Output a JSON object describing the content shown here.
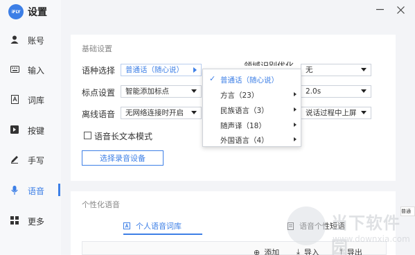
{
  "app": {
    "logo_text": "iFLY",
    "title": "设置"
  },
  "sidebar": {
    "items": [
      {
        "label": "账号",
        "icon": "user-icon"
      },
      {
        "label": "输入",
        "icon": "keyboard-icon"
      },
      {
        "label": "词库",
        "icon": "dictionary-icon"
      },
      {
        "label": "按键",
        "icon": "key-icon"
      },
      {
        "label": "手写",
        "icon": "pen-icon"
      },
      {
        "label": "语音",
        "icon": "microphone-icon",
        "active": true
      },
      {
        "label": "更多",
        "icon": "grid-icon"
      }
    ]
  },
  "window": {
    "minimize_glyph": "—",
    "close_glyph": "✕"
  },
  "basic": {
    "section_title": "基础设置",
    "language_label": "语种选择",
    "language_value": "普通话（随心说）",
    "punct_label": "标点设置",
    "punct_value": "智能添加标点",
    "offline_label": "离线语音",
    "offline_value": "无网络连接时开启",
    "domain_label_partial": "领域识别优化",
    "domain_value": "无",
    "delay_value": "2.0s",
    "onscreen_value": "说话过程中上屏",
    "longtext_label": "语音长文本模式",
    "select_device_button": "选择录音设备"
  },
  "language_menu": {
    "items": [
      {
        "label": "普通话（随心说）",
        "checked": true,
        "submenu": false
      },
      {
        "label": "方言（23）",
        "checked": false,
        "submenu": true
      },
      {
        "label": "民族语言（3）",
        "checked": false,
        "submenu": true
      },
      {
        "label": "随声译（18）",
        "checked": false,
        "submenu": true
      },
      {
        "label": "外国语言（4）",
        "checked": false,
        "submenu": true
      }
    ]
  },
  "personal": {
    "section_title": "个性化语音",
    "tab_personal": "个人语音词库",
    "tab_personal_icon": "book-icon",
    "tab_phrases": "语音个性短语",
    "tab_phrases_icon": "document-icon",
    "add_label": "添加",
    "import_label": "导入",
    "export_label": "导出"
  },
  "side_hint": "普通",
  "watermark": {
    "text": "当下软件园",
    "url": "www.downxia.com"
  },
  "colors": {
    "accent": "#3d7fe6",
    "background": "#f3f4f7",
    "card": "#ffffff"
  }
}
